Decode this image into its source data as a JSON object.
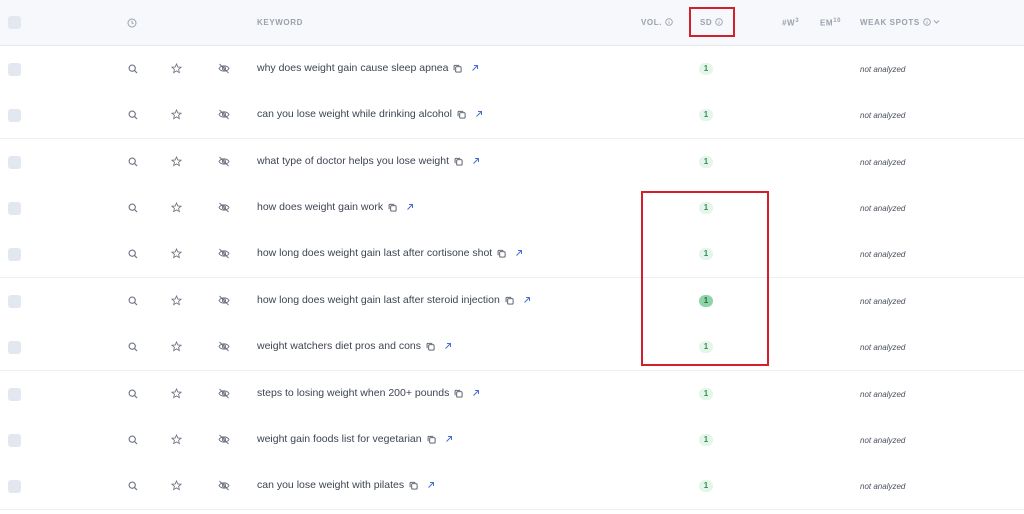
{
  "header": {
    "keyword": "KEYWORD",
    "vol": "VOL.",
    "sd": "SD",
    "w": "#W",
    "w_sup": "3",
    "em": "EM",
    "em_sup": "10",
    "weak_spots": "WEAK SPOTS"
  },
  "status_text": "not analyzed",
  "rows": [
    {
      "keyword": "why does weight gain cause sleep apnea",
      "sd": "1"
    },
    {
      "keyword": "can you lose weight while drinking alcohol",
      "sd": "1"
    },
    {
      "keyword": "what type of doctor helps you lose weight",
      "sd": "1"
    },
    {
      "keyword": "how does weight gain work",
      "sd": "1"
    },
    {
      "keyword": "how long does weight gain last after cortisone shot",
      "sd": "1"
    },
    {
      "keyword": "how long does weight gain last after steroid injection",
      "sd": "1"
    },
    {
      "keyword": "weight watchers diet pros and cons",
      "sd": "1"
    },
    {
      "keyword": "steps to losing weight when 200+ pounds",
      "sd": "1"
    },
    {
      "keyword": "weight gain foods list for vegetarian",
      "sd": "1"
    },
    {
      "keyword": "can you lose weight with pilates",
      "sd": "1"
    }
  ],
  "colors": {
    "highlight": "#d2202f",
    "pill_bg": "#e4f5ea",
    "pill_text": "#3a8d5a"
  },
  "icons": {
    "row": [
      "search-icon",
      "star-icon",
      "eye-off-icon",
      "copy-icon",
      "external-link-icon"
    ],
    "header": [
      "clock-icon",
      "info-icon",
      "chevron-down-icon"
    ]
  }
}
